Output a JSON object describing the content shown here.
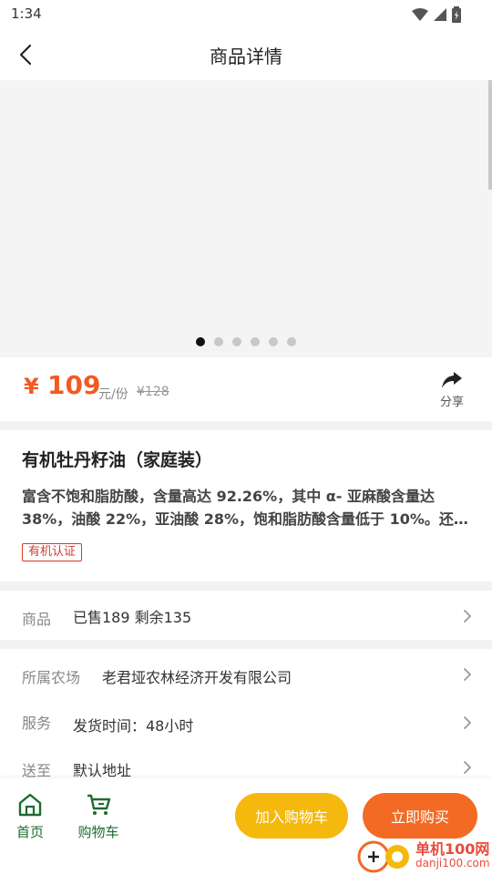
{
  "status_bar": {
    "time": "1:34"
  },
  "nav": {
    "title": "商品详情"
  },
  "gallery": {
    "dot_count": 6,
    "active_index": 0
  },
  "price": {
    "currency": "¥",
    "value": "109",
    "unit": "元/份",
    "original": "¥128"
  },
  "share": {
    "label": "分享"
  },
  "product": {
    "title": "有机牡丹籽油（家庭装）",
    "description": "富含不饱和脂肪酸，含量高达 92.26%，其中 α- 亚麻酸含量达 38%，油酸 22%，亚油酸 28%，饱和脂肪酸含量低于 10%。还…",
    "tag": "有机认证"
  },
  "rows": {
    "goods": {
      "label": "商品",
      "value": "已售189  剩余135"
    },
    "farm": {
      "label": "所属农场",
      "value": "老君垭农林经济开发有限公司"
    },
    "service": {
      "label": "服务",
      "value": "发货时间：48小时"
    },
    "ship_to": {
      "label": "送至",
      "value": "默认地址"
    }
  },
  "bottom": {
    "home_label": "首页",
    "cart_label": "购物车",
    "add_cart_button": "加入购物车",
    "buy_now_button": "立即购买"
  },
  "watermark": {
    "text": "单机100网",
    "sub": "danji100.com"
  },
  "colors": {
    "accent_orange": "#f25a22",
    "accent_yellow": "#f5b80c",
    "tab_green": "#1e6b2f",
    "tag_red": "#d23c2c"
  }
}
